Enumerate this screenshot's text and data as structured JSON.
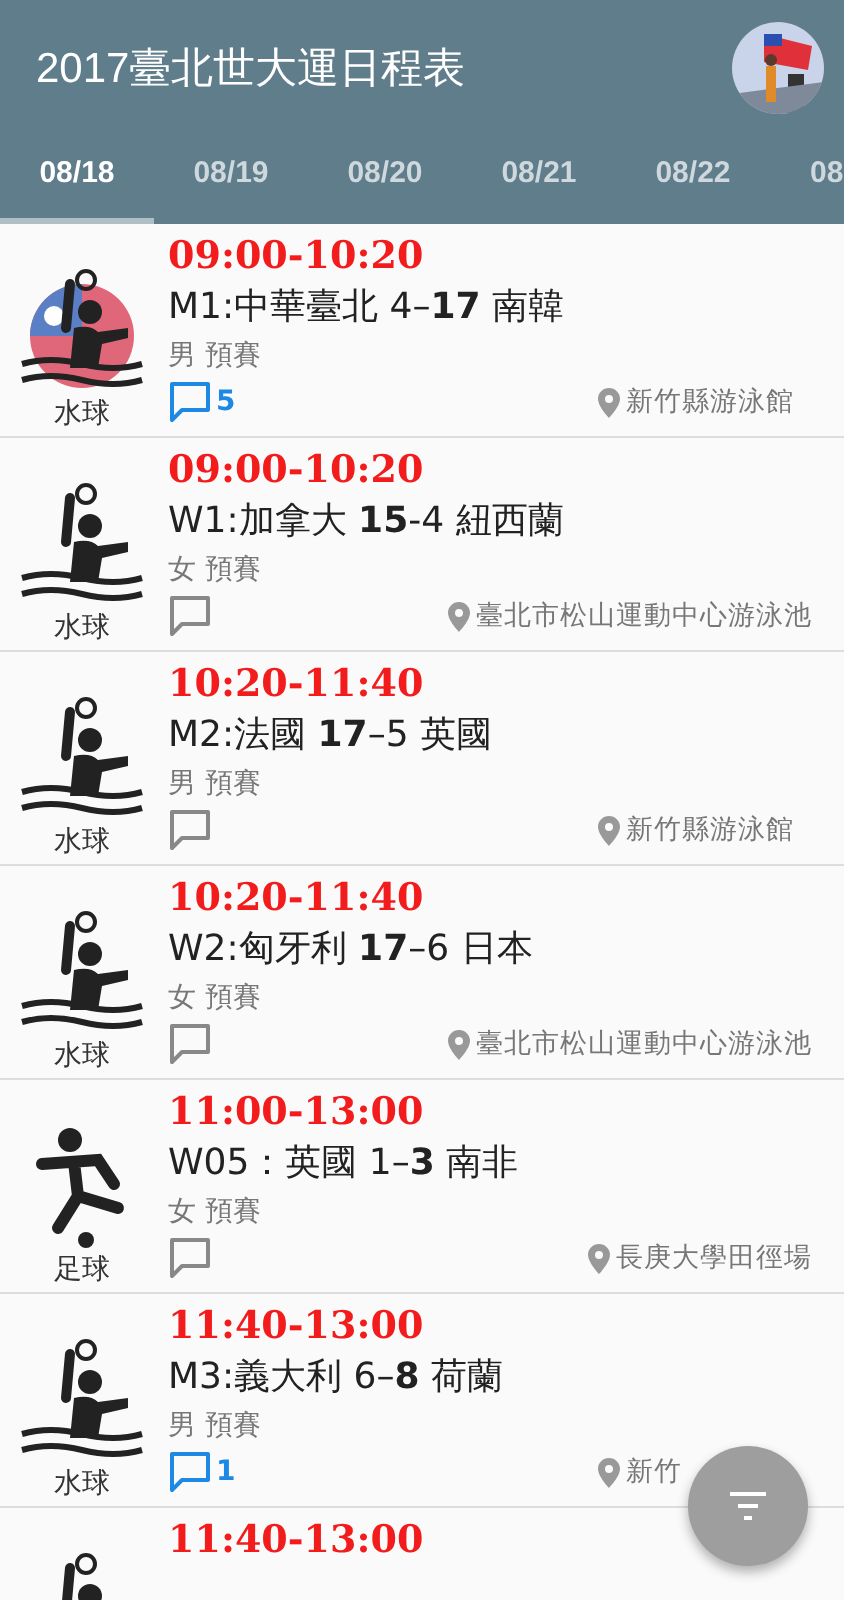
{
  "app_bar": {
    "title": "2017臺北世大運日程表"
  },
  "tabs": [
    {
      "label": "08/18",
      "selected": true
    },
    {
      "label": "08/19",
      "selected": false
    },
    {
      "label": "08/20",
      "selected": false
    },
    {
      "label": "08/21",
      "selected": false
    },
    {
      "label": "08/22",
      "selected": false
    },
    {
      "label": "08",
      "selected": false
    }
  ],
  "events": [
    {
      "kind": "water_polo",
      "sport": "水球",
      "featured": true,
      "time": "09:00-10:20",
      "match": "M1:中華臺北 4–**17** 南韓",
      "category": "男 預賽",
      "comments": "5",
      "venue": "新竹縣游泳館"
    },
    {
      "kind": "water_polo",
      "sport": "水球",
      "featured": false,
      "time": "09:00-10:20",
      "match": "W1:加拿大 **15**-4 紐西蘭",
      "category": "女 預賽",
      "venue": "臺北市松山運動中心游泳池"
    },
    {
      "kind": "water_polo",
      "sport": "水球",
      "featured": false,
      "time": "10:20-11:40",
      "match": "M2:法國 **17**–5 英國",
      "category": "男 預賽",
      "venue": "新竹縣游泳館"
    },
    {
      "kind": "water_polo",
      "sport": "水球",
      "featured": false,
      "time": "10:20-11:40",
      "match": "W2:匈牙利 **17**–6 日本",
      "category": "女 預賽",
      "venue": "臺北市松山運動中心游泳池"
    },
    {
      "kind": "football",
      "sport": "足球",
      "featured": false,
      "time": "11:00-13:00",
      "match": "W05：英國 1–**3** 南非",
      "category": "女 預賽",
      "venue": "長庚大學田徑場"
    },
    {
      "kind": "water_polo",
      "sport": "水球",
      "featured": false,
      "time": "11:40-13:00",
      "match": "M3:義大利 6–**8** 荷蘭",
      "category": "男 預賽",
      "comments": "1",
      "venue": "新竹"
    },
    {
      "kind": "water_polo",
      "featured": false,
      "time": "11:40-13:00"
    }
  ],
  "fab": {
    "kind": "filter"
  }
}
